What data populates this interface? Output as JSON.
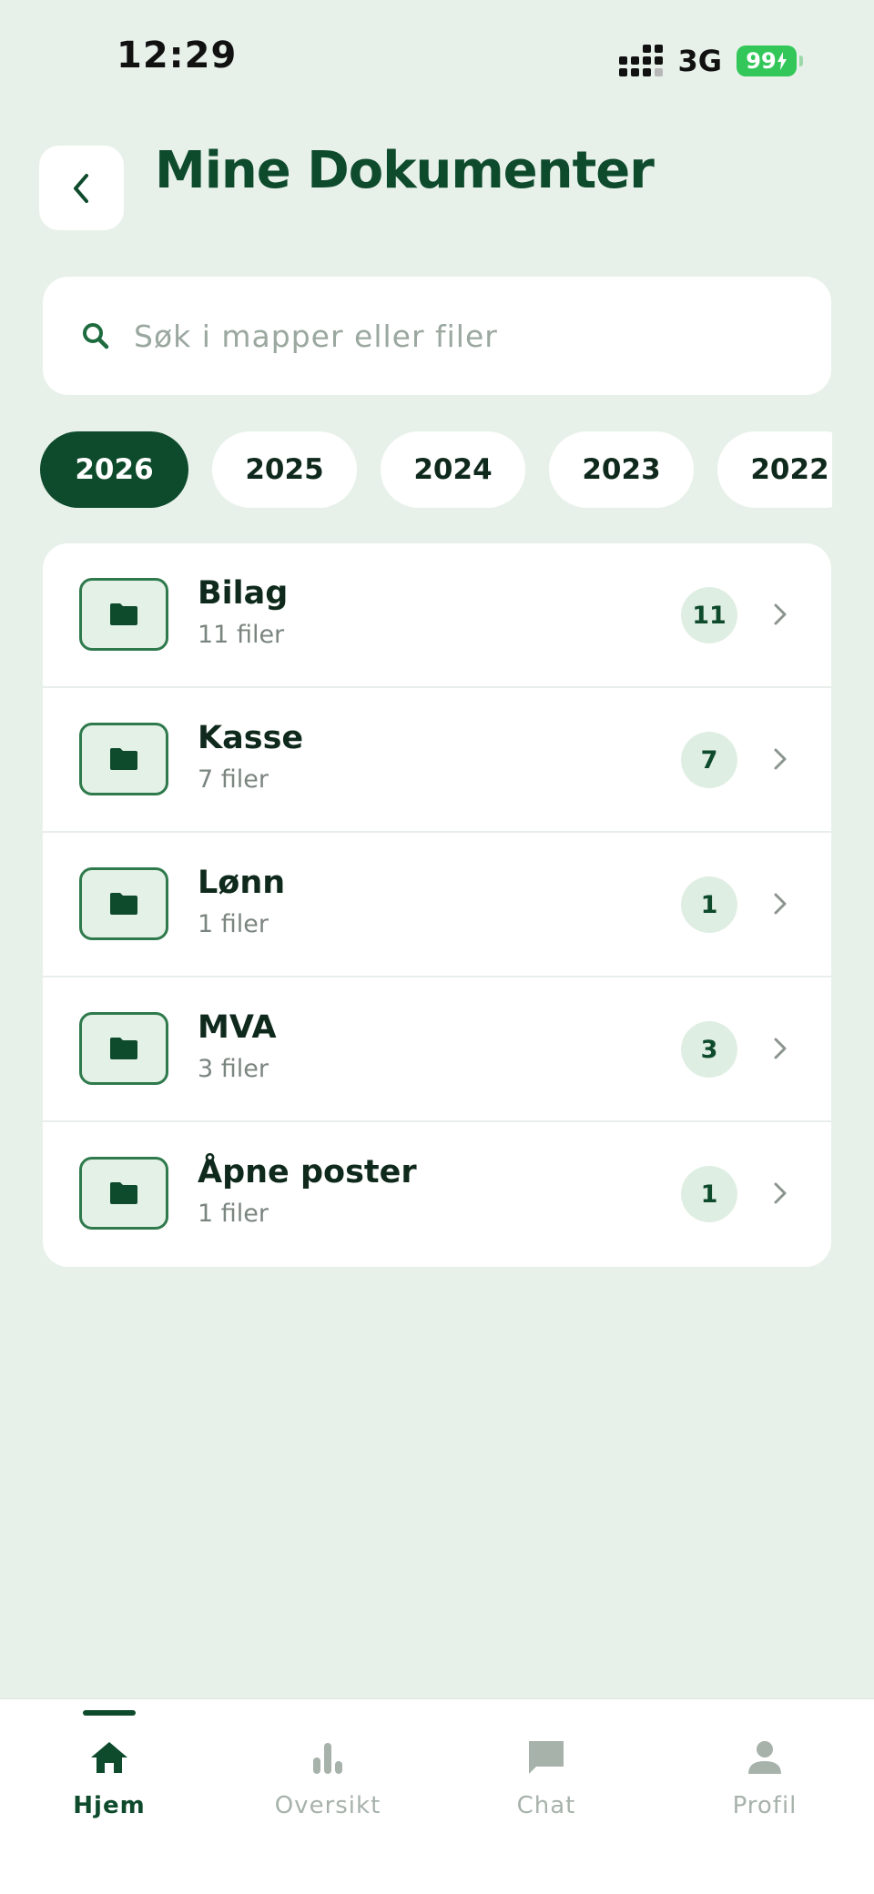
{
  "status": {
    "time": "12:29",
    "network": "3G",
    "battery": "99"
  },
  "header": {
    "title": "Mine Dokumenter",
    "back_icon": "chevron-left-icon"
  },
  "search": {
    "placeholder": "Søk i mapper eller filer",
    "value": "",
    "icon": "search-icon"
  },
  "years": {
    "selected": "2026",
    "items": [
      "2026",
      "2025",
      "2024",
      "2023",
      "2022"
    ]
  },
  "folders": [
    {
      "name": "Bilag",
      "subtitle": "11 filer",
      "count": "11"
    },
    {
      "name": "Kasse",
      "subtitle": "7 filer",
      "count": "7"
    },
    {
      "name": "Lønn",
      "subtitle": "1 filer",
      "count": "1"
    },
    {
      "name": "MVA",
      "subtitle": "3 filer",
      "count": "3"
    },
    {
      "name": "Åpne poster",
      "subtitle": "1 filer",
      "count": "1"
    }
  ],
  "nav": {
    "active": "Hjem",
    "items": [
      {
        "label": "Hjem",
        "icon": "home-icon"
      },
      {
        "label": "Oversikt",
        "icon": "bar-chart-icon"
      },
      {
        "label": "Chat",
        "icon": "chat-icon"
      },
      {
        "label": "Profil",
        "icon": "person-icon"
      }
    ]
  },
  "colors": {
    "primary": "#0e4a2c",
    "background": "#e7f1e9",
    "badge_bg": "#dfeee2",
    "battery": "#33c759"
  }
}
